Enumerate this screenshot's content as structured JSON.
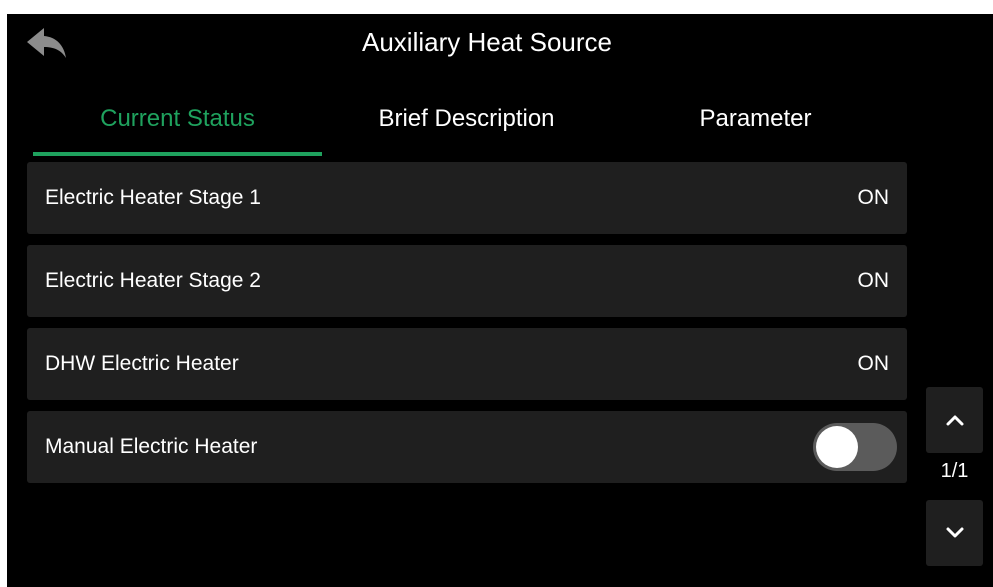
{
  "header": {
    "title": "Auxiliary Heat Source",
    "back_icon": "back-arrow-icon"
  },
  "tabs": [
    {
      "label": "Current Status",
      "active": true
    },
    {
      "label": "Brief Description",
      "active": false
    },
    {
      "label": "Parameter",
      "active": false
    }
  ],
  "rows": [
    {
      "label": "Electric Heater Stage 1",
      "value": "ON"
    },
    {
      "label": "Electric Heater Stage 2",
      "value": "ON"
    },
    {
      "label": "DHW Electric Heater",
      "value": "ON"
    },
    {
      "label": "Manual Electric Heater",
      "toggle_on": false
    }
  ],
  "pager": {
    "page": "1/1",
    "up_icon": "chevron-up-icon",
    "down_icon": "chevron-down-icon"
  },
  "colors": {
    "background": "#000000",
    "row_bg": "#1f1f1f",
    "accent": "#1fa25e",
    "toggle_off_track": "#5b5b5b",
    "text": "#ffffff"
  }
}
